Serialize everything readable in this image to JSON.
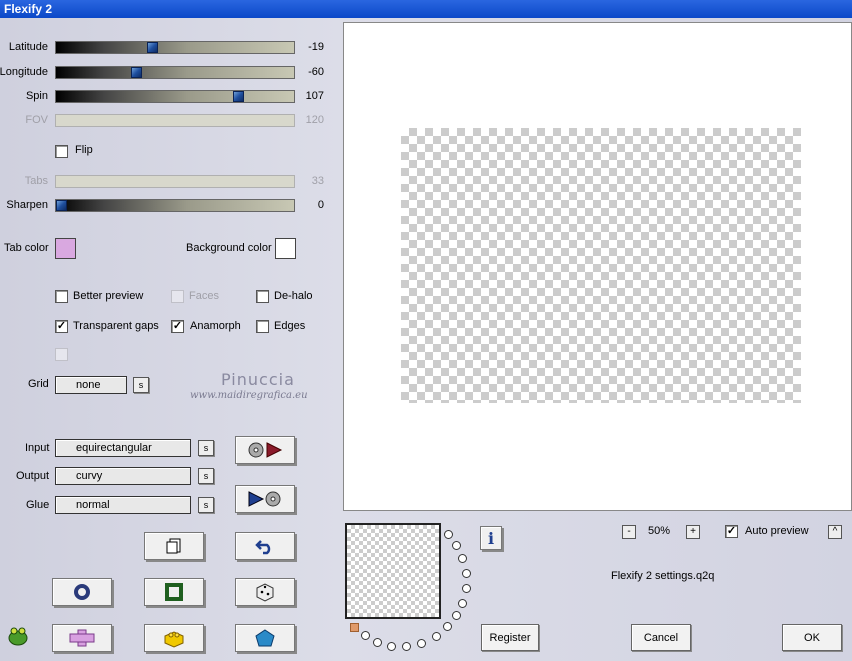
{
  "window": {
    "title": "Flexify 2"
  },
  "sliders": [
    {
      "label": "Latitude",
      "value": "-19",
      "level": 0.4,
      "enabled": true
    },
    {
      "label": "Longitude",
      "value": "-60",
      "level": 0.33,
      "enabled": true
    },
    {
      "label": "Spin",
      "value": "107",
      "level": 0.78,
      "enabled": true
    },
    {
      "label": "FOV",
      "value": "120",
      "level": null,
      "enabled": false
    },
    {
      "label": "Tabs",
      "value": "33",
      "level": null,
      "enabled": false
    },
    {
      "label": "Sharpen",
      "value": "0",
      "level": 0.0,
      "enabled": true
    }
  ],
  "flip": {
    "label": "Flip",
    "checked": false
  },
  "colors": {
    "tab_label": "Tab color",
    "tab_color": "#d9a8e0",
    "bg_label": "Background color",
    "bg_color": "#ffffff"
  },
  "options": {
    "better_preview": {
      "label": "Better preview",
      "checked": false
    },
    "faces": {
      "label": "Faces",
      "checked": false
    },
    "de_halo": {
      "label": "De-halo",
      "checked": false
    },
    "transparent_gaps": {
      "label": "Transparent gaps",
      "checked": true
    },
    "anamorph": {
      "label": "Anamorph",
      "checked": true
    },
    "edges": {
      "label": "Edges",
      "checked": false
    }
  },
  "grid": {
    "label": "Grid",
    "value": "none",
    "s": "s"
  },
  "watermark": {
    "line1": "Pinuccia",
    "line2": "www.maidiregrafica.eu"
  },
  "projection": {
    "input_label": "Input",
    "input_value": "equirectangular",
    "output_label": "Output",
    "output_value": "curvy",
    "glue_label": "Glue",
    "glue_value": "normal",
    "s": "s"
  },
  "zoom": {
    "minus": "-",
    "value": "50%",
    "plus": "+"
  },
  "auto_preview": {
    "label": "Auto preview",
    "checked": true,
    "collapse": "^"
  },
  "settings_file": "Flexify 2 settings.q2q",
  "info_icon": "i",
  "buttons": {
    "register": "Register",
    "cancel": "Cancel",
    "ok": "OK"
  },
  "icons": {
    "input_btn": "disc-to-arrow-icon",
    "output_btn": "arrow-to-disc-icon",
    "copy": "copy-icon",
    "undo": "undo-icon",
    "ring": "ring-icon",
    "square": "square-frame-icon",
    "dice": "dice-icon",
    "cross": "cross-icon",
    "brick": "brick-icon",
    "pentagon": "pentagon-icon",
    "logo": "frog-logo-icon"
  }
}
